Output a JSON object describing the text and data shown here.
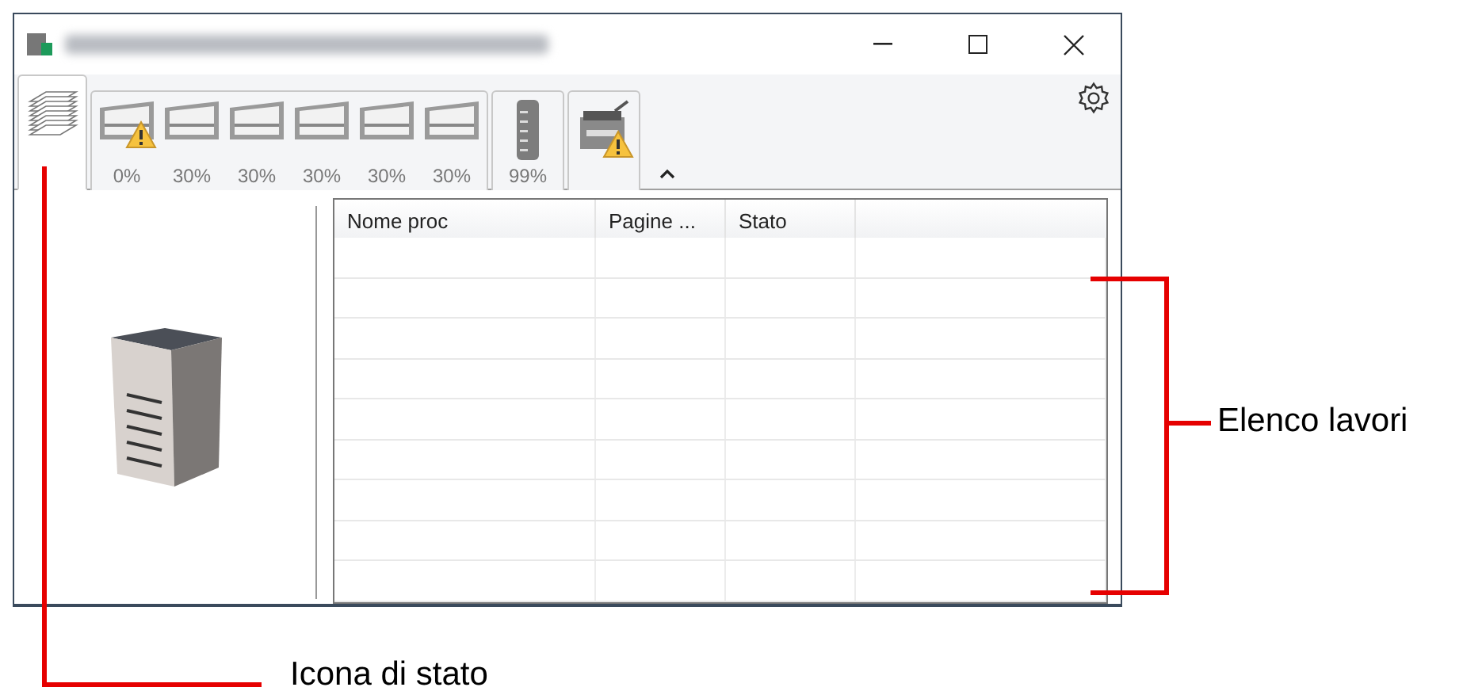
{
  "tabs": [
    {
      "kind": "jobs",
      "selected": true
    },
    {
      "kind": "trays",
      "selected": false,
      "trays": [
        {
          "reading": "0%",
          "warning": true
        },
        {
          "reading": "30%",
          "warning": false
        },
        {
          "reading": "30%",
          "warning": false
        },
        {
          "reading": "30%",
          "warning": false
        },
        {
          "reading": "30%",
          "warning": false
        },
        {
          "reading": "30%",
          "warning": false
        }
      ]
    },
    {
      "kind": "toner",
      "selected": false,
      "reading": "99%"
    },
    {
      "kind": "device",
      "selected": false,
      "warning": true
    }
  ],
  "table": {
    "columns": [
      "Nome proc",
      "Pagine ...",
      "Stato"
    ]
  },
  "annotations": [
    {
      "kind": "bracket",
      "label": "Elenco lavori"
    },
    {
      "kind": "elbow",
      "label": "Icona di stato"
    }
  ]
}
